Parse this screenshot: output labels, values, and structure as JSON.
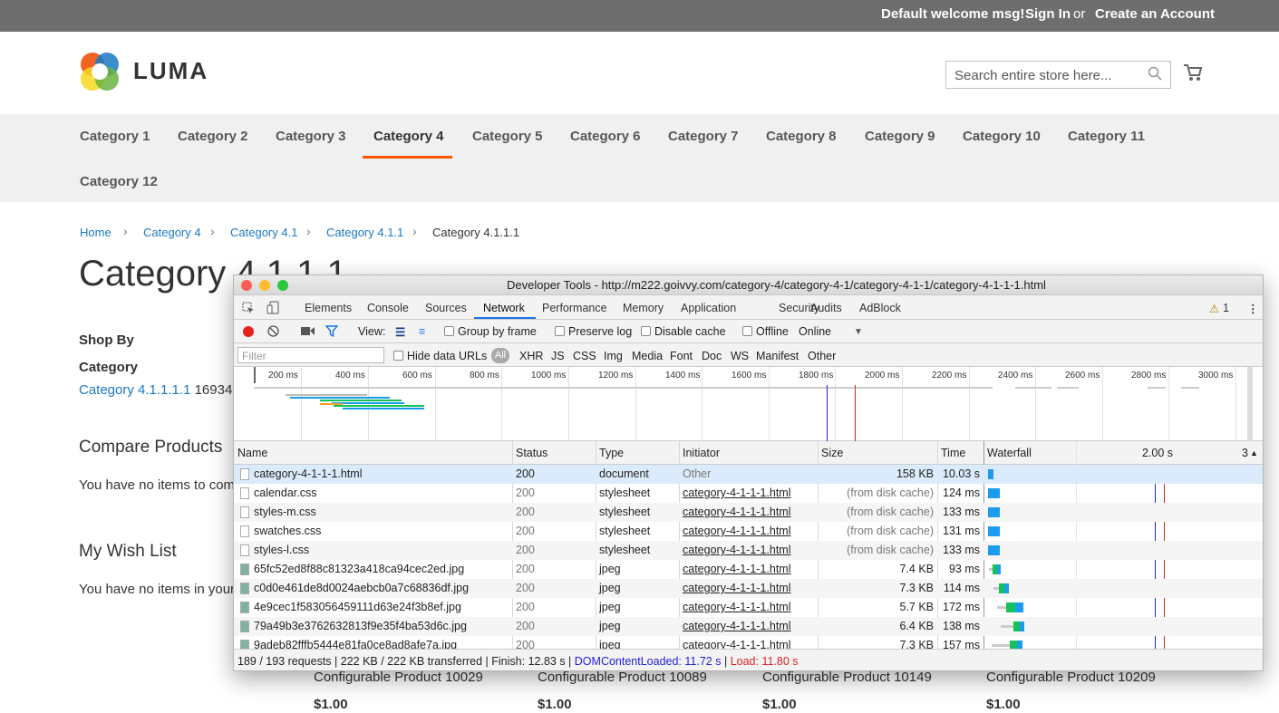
{
  "header": {
    "welcome": "Default welcome msg!",
    "sign_in": "Sign In",
    "or": "or",
    "create_account": "Create an Account"
  },
  "logo": {
    "text": "LUMA"
  },
  "search": {
    "placeholder": "Search entire store here..."
  },
  "nav": {
    "items": [
      "Category 1",
      "Category 2",
      "Category 3",
      "Category 4",
      "Category 5",
      "Category 6",
      "Category 7",
      "Category 8",
      "Category 9",
      "Category 10",
      "Category 11",
      "Category 12"
    ],
    "active": "Category 4"
  },
  "breadcrumb": [
    "Home",
    "Category 4",
    "Category 4.1",
    "Category 4.1.1",
    "Category 4.1.1.1"
  ],
  "page_title": "Category 4.1.1.1",
  "sidebar": {
    "shop_by": "Shop By",
    "category_heading": "Category",
    "category_link": "Category 4.1.1.1.1",
    "category_count": "16934",
    "compare_title": "Compare Products",
    "compare_text": "You have no items to com",
    "wishlist_title": "My Wish List",
    "wishlist_text": "You have no items in your"
  },
  "products": [
    {
      "name": "Configurable Product 10029",
      "price": "$1.00"
    },
    {
      "name": "Configurable Product 10089",
      "price": "$1.00"
    },
    {
      "name": "Configurable Product 10149",
      "price": "$1.00"
    },
    {
      "name": "Configurable Product 10209",
      "price": "$1.00"
    }
  ],
  "devtools": {
    "title": "Developer Tools - http://m222.goivvy.com/category-4/category-4-1/category-4-1-1/category-4-1-1-1.html",
    "tabs": [
      "Elements",
      "Console",
      "Sources",
      "Network",
      "Performance",
      "Memory",
      "Application",
      "Security",
      "Audits",
      "AdBlock"
    ],
    "active_tab": "Network",
    "warnings": "1",
    "toolbar": {
      "view": "View:",
      "group_by_frame": "Group by frame",
      "preserve_log": "Preserve log",
      "disable_cache": "Disable cache",
      "offline": "Offline",
      "throttle": "Online"
    },
    "filter": {
      "placeholder": "Filter",
      "hide_data_urls": "Hide data URLs",
      "types": [
        "All",
        "XHR",
        "JS",
        "CSS",
        "Img",
        "Media",
        "Font",
        "Doc",
        "WS",
        "Manifest",
        "Other"
      ]
    },
    "timeline_ticks": [
      "200 ms",
      "400 ms",
      "600 ms",
      "800 ms",
      "1000 ms",
      "1200 ms",
      "1400 ms",
      "1600 ms",
      "1800 ms",
      "2000 ms",
      "2200 ms",
      "2400 ms",
      "2600 ms",
      "2800 ms",
      "3000 ms"
    ],
    "columns": {
      "name": "Name",
      "status": "Status",
      "type": "Type",
      "initiator": "Initiator",
      "size": "Size",
      "time": "Time",
      "waterfall": "Waterfall",
      "waterfall_time": "2.00 s",
      "waterfall_right": "3"
    },
    "rows": [
      {
        "name": "category-4-1-1-1.html",
        "status": "200",
        "type": "document",
        "initiator": "Other",
        "size": "158 KB",
        "time": "10.03 s"
      },
      {
        "name": "calendar.css",
        "status": "200",
        "type": "stylesheet",
        "initiator": "category-4-1-1-1.html",
        "size": "(from disk cache)",
        "time": "124 ms"
      },
      {
        "name": "styles-m.css",
        "status": "200",
        "type": "stylesheet",
        "initiator": "category-4-1-1-1.html",
        "size": "(from disk cache)",
        "time": "133 ms"
      },
      {
        "name": "swatches.css",
        "status": "200",
        "type": "stylesheet",
        "initiator": "category-4-1-1-1.html",
        "size": "(from disk cache)",
        "time": "131 ms"
      },
      {
        "name": "styles-l.css",
        "status": "200",
        "type": "stylesheet",
        "initiator": "category-4-1-1-1.html",
        "size": "(from disk cache)",
        "time": "133 ms"
      },
      {
        "name": "65fc52ed8f88c81323a418ca94cec2ed.jpg",
        "status": "200",
        "type": "jpeg",
        "initiator": "category-4-1-1-1.html",
        "size": "7.4 KB",
        "time": "93 ms"
      },
      {
        "name": "c0d0e461de8d0024aebcb0a7c68836df.jpg",
        "status": "200",
        "type": "jpeg",
        "initiator": "category-4-1-1-1.html",
        "size": "7.3 KB",
        "time": "114 ms"
      },
      {
        "name": "4e9cec1f583056459111d63e24f3b8ef.jpg",
        "status": "200",
        "type": "jpeg",
        "initiator": "category-4-1-1-1.html",
        "size": "5.7 KB",
        "time": "172 ms"
      },
      {
        "name": "79a49b3e3762632813f9e35f4ba53d6c.jpg",
        "status": "200",
        "type": "jpeg",
        "initiator": "category-4-1-1-1.html",
        "size": "6.4 KB",
        "time": "138 ms"
      },
      {
        "name": "9adeb82fffb5444e81fa0ce8ad8afe7a.jpg",
        "status": "200",
        "type": "jpeg",
        "initiator": "category-4-1-1-1.html",
        "size": "7.3 KB",
        "time": "157 ms"
      }
    ],
    "status_bar": {
      "summary": "189 / 193 requests | 222 KB / 222 KB transferred | Finish: 12.83 s |",
      "dom": "DOMContentLoaded: 11.72 s",
      "sep": "|",
      "load": "Load: 11.80 s"
    },
    "colors": {
      "dom": "#2222dd",
      "load": "#dd2222",
      "accent": "#1a73e8",
      "waterfall_blue": "#1a9cf0",
      "waterfall_green": "#16c15a"
    }
  }
}
